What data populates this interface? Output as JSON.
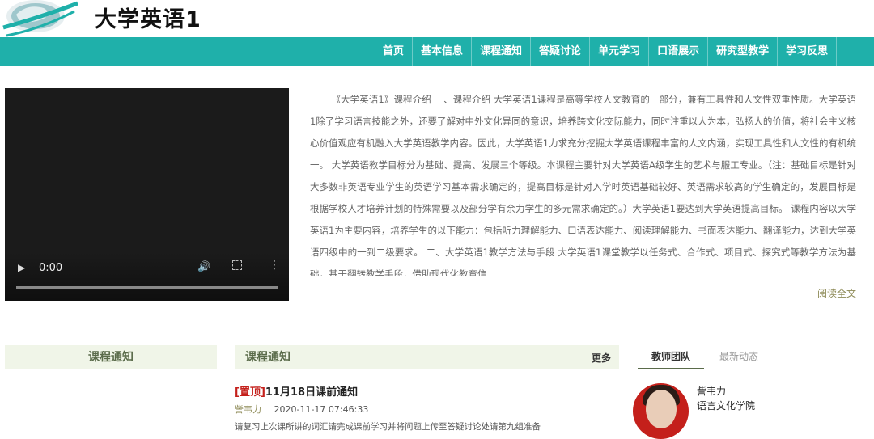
{
  "site": {
    "title": "大学英语1"
  },
  "nav": {
    "items": [
      "首页",
      "基本信息",
      "课程通知",
      "答疑讨论",
      "单元学习",
      "口语展示",
      "研究型教学",
      "学习反思"
    ]
  },
  "video": {
    "time": "0:00"
  },
  "intro": {
    "text": "《大学英语1》课程介绍 一、课程介绍 大学英语1课程是高等学校人文教育的一部分，兼有工具性和人文性双重性质。大学英语1除了学习语言技能之外，还要了解对中外文化异同的意识，培养跨文化交际能力，同时注重以人为本，弘扬人的价值，将社会主义核心价值观应有机融入大学英语教学内容。因此，大学英语1力求充分挖掘大学英语课程丰富的人文内涵，实现工具性和人文性的有机统一。 大学英语教学目标分为基础、提高、发展三个等级。本课程主要针对大学英语A级学生的艺术与服工专业。（注：基础目标是针对大多数非英语专业学生的英语学习基本需求确定的，提高目标是针对入学时英语基础较好、英语需求较高的学生确定的，发展目标是根据学校人才培养计划的特殊需要以及部分学有余力学生的多元需求确定的。）大学英语1要达到大学英语提高目标。 课程内容以大学英语1为主要内容，培养学生的以下能力：包括听力理解能力、口语表达能力、阅读理解能力、书面表达能力、翻译能力，达到大学英语四级中的一到二级要求。 二、大学英语1教学方法与手段 大学英语1课堂教学以任务式、合作式、项目式、探究式等教学方法为基础，基于翻转教学手段，借助现代化教育信",
    "read_more": "阅读全文"
  },
  "left_panel": {
    "title": "课程通知"
  },
  "notices": {
    "title": "课程通知",
    "more": "更多",
    "item": {
      "pin": "[置顶]",
      "title": "11月18日课前通知",
      "author": "訾韦力",
      "datetime": "2020-11-17 07:46:33",
      "desc": "请复习上次课所讲的词汇请完成课前学习并将问题上传至答疑讨论处请第九组准备"
    }
  },
  "right_panel": {
    "tabs": [
      "教师团队",
      "最新动态"
    ],
    "teacher": {
      "name": "訾韦力",
      "school": "语言文化学院"
    }
  },
  "colors": {
    "nav_bg": "#1fb0aa",
    "panel_bg": "#f0f5e8",
    "pin": "#c4201b",
    "accent": "#8d8a56"
  }
}
